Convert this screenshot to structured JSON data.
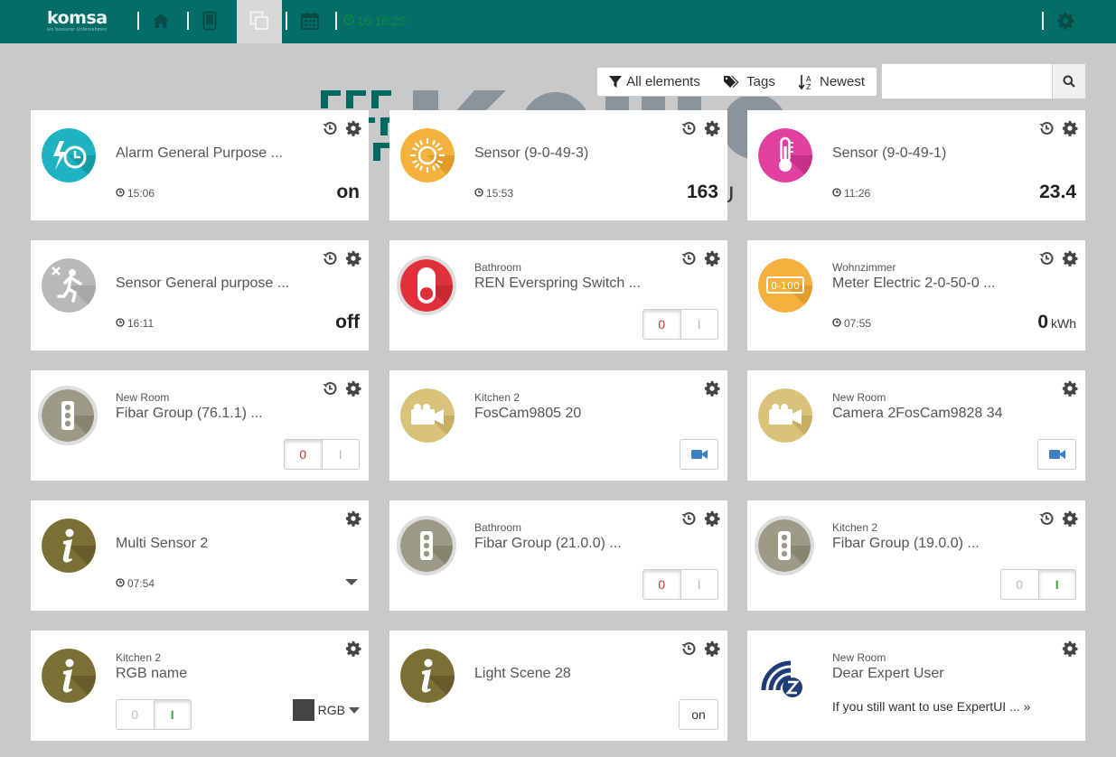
{
  "header": {
    "logo": "komsa",
    "logo_sub": "ein besserer Unternehmen",
    "clock": "16:16:25"
  },
  "toolbar": {
    "filter_label": "All elements",
    "tags_label": "Tags",
    "sort_label": "Newest",
    "search_value": ""
  },
  "colors": {
    "header": "#036e68",
    "clock": "#0d8a3c",
    "background": "#c9c9c9"
  },
  "cards": [
    {
      "room": "",
      "name": "Alarm General Purpose ...",
      "time": "15:06",
      "value": "on",
      "icon": "alarm-clock-icon"
    },
    {
      "room": "",
      "name": "Sensor (9-0-49-3)",
      "time": "15:53",
      "value": "163",
      "icon": "sun-icon"
    },
    {
      "room": "",
      "name": "Sensor (9-0-49-1)",
      "time": "11:26",
      "value": "23.4",
      "icon": "thermometer-icon"
    },
    {
      "room": "",
      "name": "Sensor General purpose ...",
      "time": "16:11",
      "value": "off",
      "icon": "motion-icon"
    },
    {
      "room": "Bathroom",
      "name": "REN Everspring Switch ...",
      "off_label": "0",
      "on_label": "I",
      "icon": "switch-icon"
    },
    {
      "room": "Wohnzimmer",
      "name": "Meter Electric 2-0-50-0 ...",
      "time": "07:55",
      "value": "0",
      "unit": "kWh",
      "icon": "meter-icon",
      "meter_text": "0-100"
    },
    {
      "room": "New Room",
      "name": "Fibar Group (76.1.1) ...",
      "off_label": "0",
      "on_label": "I",
      "icon": "traffic-light-icon"
    },
    {
      "room": "Kitchen 2",
      "name": "FosCam9805 20",
      "icon": "camera-icon"
    },
    {
      "room": "New Room",
      "name": "Camera 2FosCam9828 34",
      "icon": "camera-icon"
    },
    {
      "room": "",
      "name": "Multi Sensor 2",
      "time": "07:54",
      "icon": "info-icon"
    },
    {
      "room": "Bathroom",
      "name": "Fibar Group (21.0.0) ...",
      "off_label": "0",
      "on_label": "I",
      "icon": "traffic-light-icon"
    },
    {
      "room": "Kitchen 2",
      "name": "Fibar Group (19.0.0) ...",
      "off_label": "0",
      "on_label": "I",
      "icon": "traffic-light-icon"
    },
    {
      "room": "Kitchen 2",
      "name": "RGB name",
      "off_label": "0",
      "on_label": "I",
      "rgb_label": "RGB",
      "icon": "info-icon"
    },
    {
      "room": "",
      "name": "Light Scene 28",
      "button_label": "on",
      "icon": "info-icon"
    },
    {
      "room": "New Room",
      "name": "Dear Expert User",
      "link": "If you still want to use ExpertUI ... »",
      "icon": "zwave-icon"
    }
  ]
}
